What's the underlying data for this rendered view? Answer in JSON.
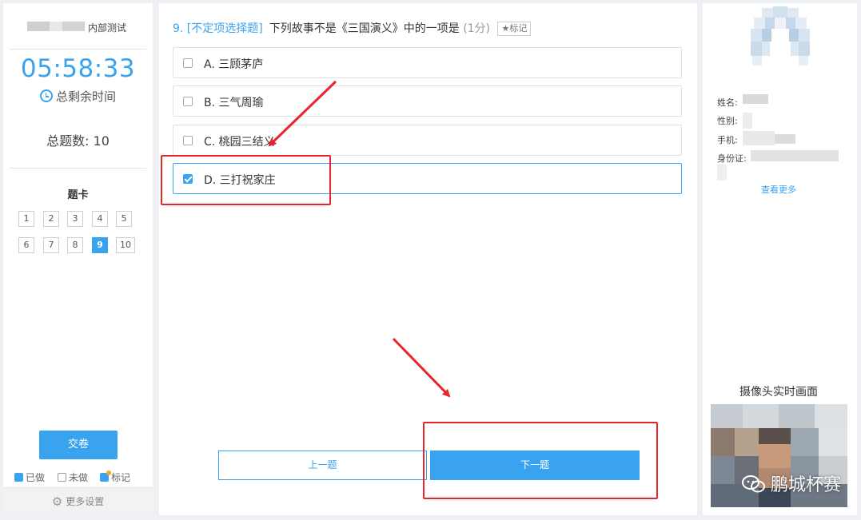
{
  "left_panel": {
    "exam_title": "内部测试",
    "timer": "05:58:33",
    "remaining_label": "总剩余时间",
    "total_questions": "总题数: 10",
    "card_title": "题卡",
    "question_numbers": [
      "1",
      "2",
      "3",
      "4",
      "5",
      "6",
      "7",
      "8",
      "9",
      "10"
    ],
    "current_question": "9",
    "submit_label": "交卷",
    "legend": {
      "done": "已做",
      "todo": "未做",
      "marked": "标记"
    },
    "more_settings": "更多设置"
  },
  "question": {
    "type_label": "9. [不定项选择题]",
    "text": "下列故事不是《三国演义》中的一项是",
    "score": "(1分)",
    "mark_label": "标记",
    "options": [
      {
        "label": "A. 三顾茅庐",
        "selected": false
      },
      {
        "label": "B. 三气周瑜",
        "selected": false
      },
      {
        "label": "C. 桃园三结义",
        "selected": false
      },
      {
        "label": "D. 三打祝家庄",
        "selected": true
      }
    ]
  },
  "nav": {
    "prev_label": "上一题",
    "next_label": "下一题"
  },
  "right_panel": {
    "name_label": "姓名:",
    "gender_label": "性别:",
    "phone_label": "手机:",
    "id_label": "身份证:",
    "see_more": "查看更多",
    "camera_title": "摄像头实时画面",
    "watermark": "鹏城杯赛"
  },
  "colors": {
    "accent": "#3aa3f0",
    "annotation": "#e8252b",
    "background": "#eef0f3"
  }
}
